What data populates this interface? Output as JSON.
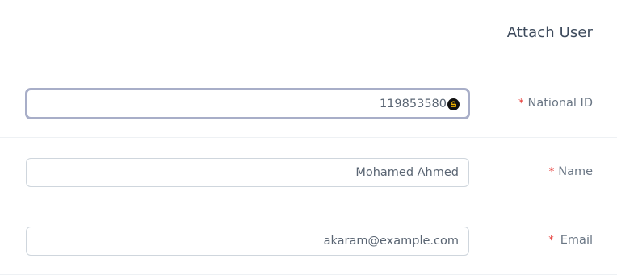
{
  "dialog": {
    "title": "Attach User"
  },
  "form": {
    "national_id": {
      "label": "National ID",
      "required_mark": "*",
      "value": "119853580"
    },
    "name": {
      "label": "Name",
      "required_mark": "*",
      "value": "Mohamed Ahmed"
    },
    "email": {
      "label": "Email",
      "required_mark": "*",
      "value": "akaram@example.com"
    }
  },
  "icons": {
    "password_manager": "password-manager-icon"
  },
  "colors": {
    "required": "#e53935",
    "focus_border": "#a8aec8",
    "label": "#6b7785"
  }
}
